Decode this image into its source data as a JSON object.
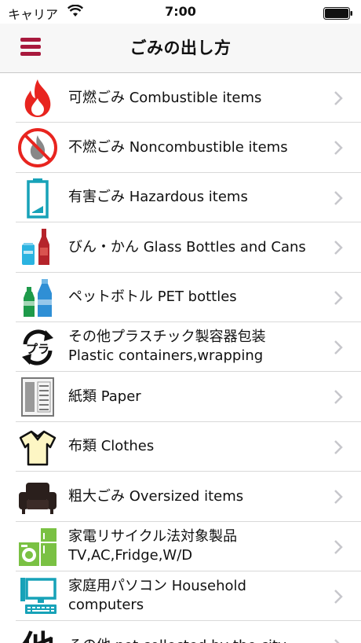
{
  "status_bar": {
    "carrier": "キャリア",
    "time": "7:00"
  },
  "header": {
    "title": "ごみの出し方"
  },
  "icons": {
    "accent": "#a8193d",
    "fire": "#e8241f",
    "teal": "#17a2b8",
    "green": "#1e9a4a"
  },
  "items": [
    {
      "label": "可燃ごみ Combustible items",
      "icon": "fire-icon"
    },
    {
      "label": "不燃ごみ Noncombustible items",
      "icon": "no-fire-icon"
    },
    {
      "label": "有害ごみ Hazardous items",
      "icon": "battery-icon"
    },
    {
      "label": "びん・かん Glass Bottles and Cans",
      "icon": "bottle-can-icon"
    },
    {
      "label": "ペットボトル PET bottles",
      "icon": "pet-bottle-icon"
    },
    {
      "label": "その他プラスチック製容器包装\nPlastic containers,wrapping",
      "icon": "plastic-recycle-icon"
    },
    {
      "label": "紙類 Paper",
      "icon": "newspaper-icon"
    },
    {
      "label": "布類 Clothes",
      "icon": "shirt-icon"
    },
    {
      "label": "粗大ごみ Oversized items",
      "icon": "sofa-icon"
    },
    {
      "label": "家電リサイクル法対象製品\nTV,AC,Fridge,W/D",
      "icon": "appliance-icon"
    },
    {
      "label": "家庭用パソコン Household\ncomputers",
      "icon": "computer-icon"
    },
    {
      "label": "その他 not collected by the city",
      "icon": "other-icon"
    }
  ]
}
